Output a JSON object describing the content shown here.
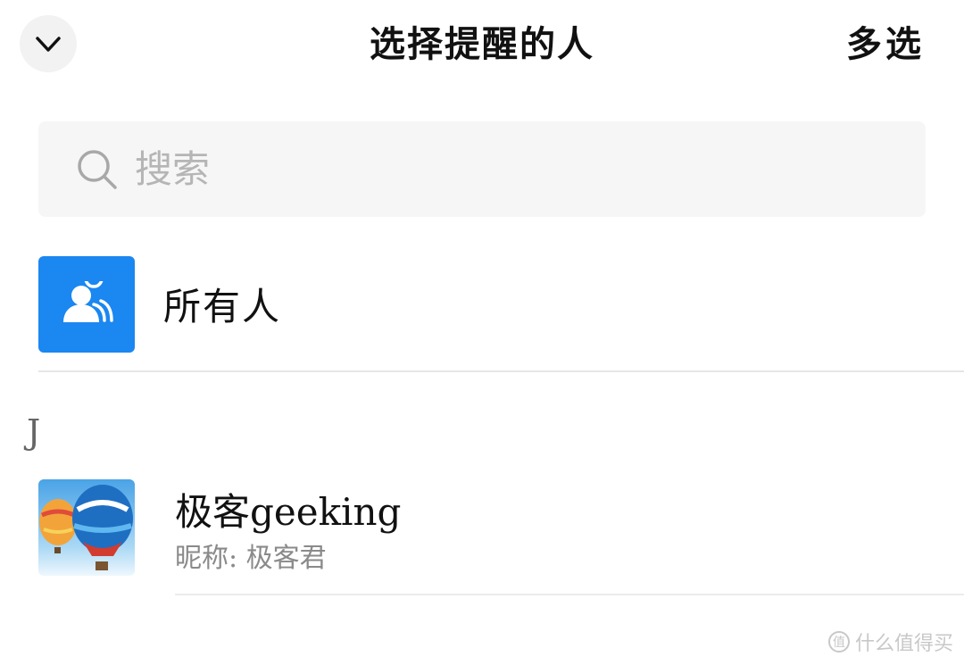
{
  "header": {
    "back_icon": "chevron-down-icon",
    "title": "选择提醒的人",
    "multi_select_label": "多选"
  },
  "search": {
    "icon": "search-icon",
    "placeholder": "搜索",
    "value": ""
  },
  "everyone": {
    "icon": "group-icon",
    "label": "所有人",
    "avatar_color": "#1b87f0"
  },
  "sections": [
    {
      "letter": "J",
      "contacts": [
        {
          "name": "极客geeking",
          "nickname": "昵称: 极客君",
          "avatar": "hot-air-balloon-avatar"
        }
      ]
    }
  ],
  "watermark": {
    "logo_char": "值",
    "text": "什么值得买"
  }
}
